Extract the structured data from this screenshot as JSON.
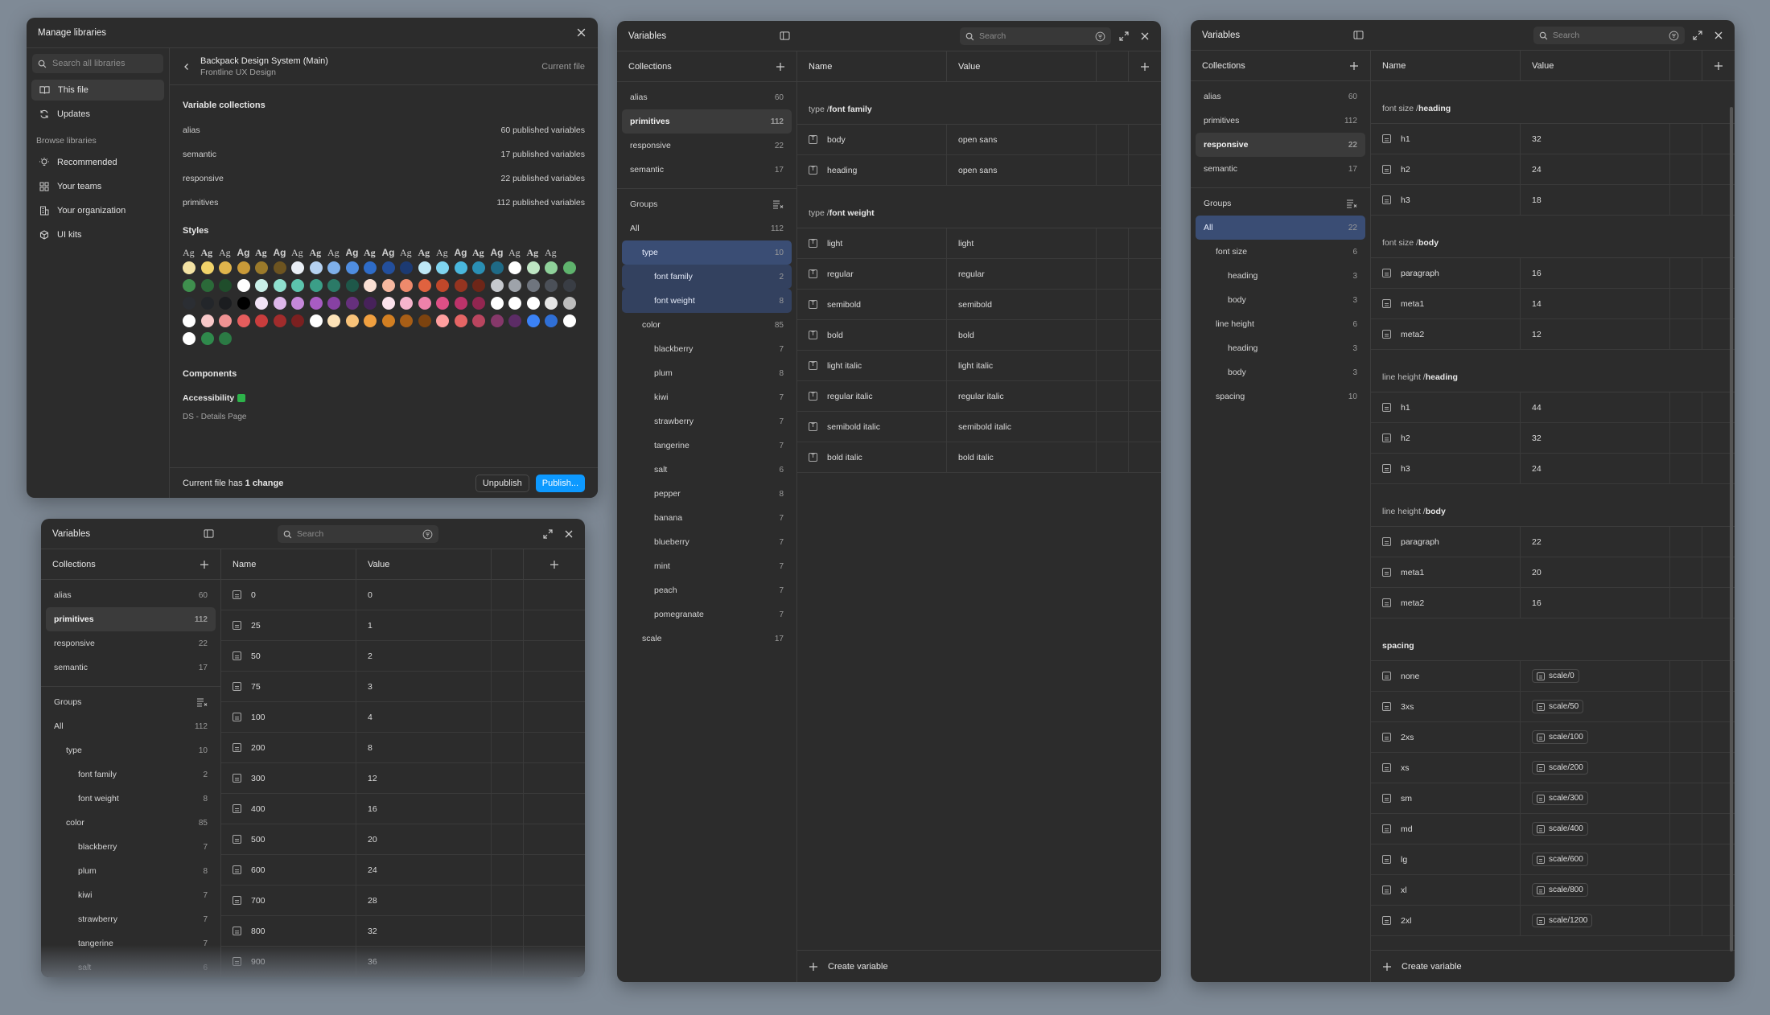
{
  "manage": {
    "title": "Manage libraries",
    "search_placeholder": "Search all libraries",
    "nav": [
      {
        "label": "This file",
        "icon": "book-icon"
      },
      {
        "label": "Updates",
        "icon": "refresh-icon"
      }
    ],
    "browse_label": "Browse libraries",
    "browse": [
      {
        "label": "Recommended",
        "icon": "bulb-icon"
      },
      {
        "label": "Your teams",
        "icon": "grid-icon"
      },
      {
        "label": "Your organization",
        "icon": "building-icon"
      },
      {
        "label": "UI kits",
        "icon": "cube-icon"
      }
    ],
    "library_name": "Backpack Design System (Main)",
    "library_team": "Frontline UX Design",
    "current_file": "Current file",
    "variable_collections_label": "Variable collections",
    "collections": [
      {
        "name": "alias",
        "count": "60 published variables"
      },
      {
        "name": "semantic",
        "count": "17 published variables"
      },
      {
        "name": "responsive",
        "count": "22 published variables"
      },
      {
        "name": "primitives",
        "count": "112 published variables"
      }
    ],
    "styles_label": "Styles",
    "ag_text": "Ag",
    "components_label": "Components",
    "accessibility": "Accessibility",
    "ds_details": "DS - Details Page",
    "footer_text_pre": "Current file has ",
    "footer_text_bold": "1 change",
    "unpublish": "Unpublish",
    "publish": "Publish...",
    "swatches": [
      "#f3e2a4",
      "#f1d36a",
      "#e0b44c",
      "#c99a38",
      "#9b7a2a",
      "#6d5420",
      "#e9eef5",
      "#b6d2f1",
      "#7fb0ea",
      "#4f8de0",
      "#2e6cc8",
      "#234f9c",
      "#1c3a72",
      "#bfe9f7",
      "#7fd4ef",
      "#49b7dd",
      "#2a8fb4",
      "#1f6a86",
      "#ffffff",
      "#bfe6c4",
      "#8fd19a",
      "#5fb36d",
      "#3f8f4e",
      "#2b6a39",
      "#1f4d2b",
      "#ffffff",
      "#c9f0e8",
      "#8fe0cf",
      "#5cc4ad",
      "#3b9f88",
      "#2b7a67",
      "#1e5749",
      "#fbe0d4",
      "#f6b8a0",
      "#ee8a6c",
      "#e0623f",
      "#c0472a",
      "#953420",
      "#6e2618",
      "#c6c9ce",
      "#9ea3aa",
      "#6f757e",
      "#4b5058",
      "#393d44",
      "#2b2e33",
      "#23262a",
      "#1b1d20",
      "#000000",
      "#f2e4f6",
      "#ddb7ea",
      "#c588da",
      "#a85cc3",
      "#8741a3",
      "#66307d",
      "#47225a",
      "#fbe2ec",
      "#f6b4cd",
      "#ee82ab",
      "#df4f86",
      "#bd336a",
      "#922650",
      "#ffffff",
      "#ffffff",
      "#ffffff",
      "#e6e6e6",
      "#bdbdbd",
      "#ffffff",
      "#f8c9c9",
      "#f09393",
      "#e55d5d",
      "#c93d3d",
      "#a12c2c",
      "#7b2020",
      "#ffffff",
      "#fde3b8",
      "#f9c379",
      "#f0a040",
      "#d27f22",
      "#a85e16",
      "#7c430f",
      "#ff9f9f",
      "#e56565",
      "#b9455f",
      "#86386a",
      "#5c2c66",
      "#3b82f6",
      "#2f6fd6",
      "#ffffff",
      "#ffffff",
      "#2f8a4c",
      "#2b7a44"
    ]
  },
  "v1": {
    "title": "Variables",
    "search_placeholder": "Search",
    "collections_label": "Collections",
    "collections": [
      {
        "label": "alias",
        "count": "60",
        "state": ""
      },
      {
        "label": "primitives",
        "count": "112",
        "state": "sel"
      },
      {
        "label": "responsive",
        "count": "22",
        "state": ""
      },
      {
        "label": "semantic",
        "count": "17",
        "state": ""
      }
    ],
    "groups_label": "Groups",
    "groups": [
      {
        "label": "All",
        "count": "112",
        "indent": 0
      },
      {
        "label": "type",
        "count": "10",
        "indent": 1
      },
      {
        "label": "font family",
        "count": "2",
        "indent": 2
      },
      {
        "label": "font weight",
        "count": "8",
        "indent": 2
      },
      {
        "label": "color",
        "count": "85",
        "indent": 1
      },
      {
        "label": "blackberry",
        "count": "7",
        "indent": 2
      },
      {
        "label": "plum",
        "count": "8",
        "indent": 2
      },
      {
        "label": "kiwi",
        "count": "7",
        "indent": 2
      },
      {
        "label": "strawberry",
        "count": "7",
        "indent": 2
      },
      {
        "label": "tangerine",
        "count": "7",
        "indent": 2
      },
      {
        "label": "salt",
        "count": "6",
        "indent": 2
      }
    ],
    "col_name": "Name",
    "col_value": "Value",
    "rows": [
      [
        "0",
        "0"
      ],
      [
        "25",
        "1"
      ],
      [
        "50",
        "2"
      ],
      [
        "75",
        "3"
      ],
      [
        "100",
        "4"
      ],
      [
        "200",
        "8"
      ],
      [
        "300",
        "12"
      ],
      [
        "400",
        "16"
      ],
      [
        "500",
        "20"
      ],
      [
        "600",
        "24"
      ],
      [
        "700",
        "28"
      ],
      [
        "800",
        "32"
      ],
      [
        "900",
        "36"
      ]
    ]
  },
  "v2": {
    "title": "Variables",
    "search_placeholder": "Search",
    "collections_label": "Collections",
    "collections": [
      {
        "label": "alias",
        "count": "60",
        "state": ""
      },
      {
        "label": "primitives",
        "count": "112",
        "state": "sel"
      },
      {
        "label": "responsive",
        "count": "22",
        "state": ""
      },
      {
        "label": "semantic",
        "count": "17",
        "state": ""
      }
    ],
    "groups_label": "Groups",
    "groups": [
      {
        "label": "All",
        "count": "112",
        "indent": 0,
        "state": ""
      },
      {
        "label": "type",
        "count": "10",
        "indent": 1,
        "state": "blue"
      },
      {
        "label": "font family",
        "count": "2",
        "indent": 2,
        "state": "bluel"
      },
      {
        "label": "font weight",
        "count": "8",
        "indent": 2,
        "state": "bluel"
      },
      {
        "label": "color",
        "count": "85",
        "indent": 1,
        "state": ""
      },
      {
        "label": "blackberry",
        "count": "7",
        "indent": 2,
        "state": ""
      },
      {
        "label": "plum",
        "count": "8",
        "indent": 2,
        "state": ""
      },
      {
        "label": "kiwi",
        "count": "7",
        "indent": 2,
        "state": ""
      },
      {
        "label": "strawberry",
        "count": "7",
        "indent": 2,
        "state": ""
      },
      {
        "label": "tangerine",
        "count": "7",
        "indent": 2,
        "state": ""
      },
      {
        "label": "salt",
        "count": "6",
        "indent": 2,
        "state": ""
      },
      {
        "label": "pepper",
        "count": "8",
        "indent": 2,
        "state": ""
      },
      {
        "label": "banana",
        "count": "7",
        "indent": 2,
        "state": ""
      },
      {
        "label": "blueberry",
        "count": "7",
        "indent": 2,
        "state": ""
      },
      {
        "label": "mint",
        "count": "7",
        "indent": 2,
        "state": ""
      },
      {
        "label": "peach",
        "count": "7",
        "indent": 2,
        "state": ""
      },
      {
        "label": "pomegranate",
        "count": "7",
        "indent": 2,
        "state": ""
      },
      {
        "label": "scale",
        "count": "17",
        "indent": 1,
        "state": ""
      }
    ],
    "col_name": "Name",
    "col_value": "Value",
    "sections": [
      {
        "prefix": "type / ",
        "bold": "font family",
        "rows": [
          [
            "body",
            "open sans"
          ],
          [
            "heading",
            "open sans"
          ]
        ]
      },
      {
        "prefix": "type / ",
        "bold": "font weight",
        "rows": [
          [
            "light",
            "light"
          ],
          [
            "regular",
            "regular"
          ],
          [
            "semibold",
            "semibold"
          ],
          [
            "bold",
            "bold"
          ],
          [
            "light italic",
            "light italic"
          ],
          [
            "regular italic",
            "regular italic"
          ],
          [
            "semibold italic",
            "semibold italic"
          ],
          [
            "bold italic",
            "bold italic"
          ]
        ]
      }
    ],
    "create_label": "Create variable"
  },
  "v3": {
    "title": "Variables",
    "search_placeholder": "Search",
    "collections_label": "Collections",
    "collections": [
      {
        "label": "alias",
        "count": "60",
        "state": ""
      },
      {
        "label": "primitives",
        "count": "112",
        "state": ""
      },
      {
        "label": "responsive",
        "count": "22",
        "state": "sel"
      },
      {
        "label": "semantic",
        "count": "17",
        "state": ""
      }
    ],
    "groups_label": "Groups",
    "groups": [
      {
        "label": "All",
        "count": "22",
        "indent": 0,
        "state": "blue"
      },
      {
        "label": "font size",
        "count": "6",
        "indent": 1,
        "state": ""
      },
      {
        "label": "heading",
        "count": "3",
        "indent": 2,
        "state": ""
      },
      {
        "label": "body",
        "count": "3",
        "indent": 2,
        "state": ""
      },
      {
        "label": "line height",
        "count": "6",
        "indent": 1,
        "state": ""
      },
      {
        "label": "heading",
        "count": "3",
        "indent": 2,
        "state": ""
      },
      {
        "label": "body",
        "count": "3",
        "indent": 2,
        "state": ""
      },
      {
        "label": "spacing",
        "count": "10",
        "indent": 1,
        "state": ""
      }
    ],
    "col_name": "Name",
    "col_value": "Value",
    "sections": [
      {
        "prefix": "font size / ",
        "bold": "heading",
        "rows": [
          [
            "h1",
            "32"
          ],
          [
            "h2",
            "24"
          ],
          [
            "h3",
            "18"
          ]
        ]
      },
      {
        "prefix": "font size / ",
        "bold": "body",
        "rows": [
          [
            "paragraph",
            "16"
          ],
          [
            "meta1",
            "14"
          ],
          [
            "meta2",
            "12"
          ]
        ]
      },
      {
        "prefix": "line height / ",
        "bold": "heading",
        "rows": [
          [
            "h1",
            "44"
          ],
          [
            "h2",
            "32"
          ],
          [
            "h3",
            "24"
          ]
        ]
      },
      {
        "prefix": "line height / ",
        "bold": "body",
        "rows": [
          [
            "paragraph",
            "22"
          ],
          [
            "meta1",
            "20"
          ],
          [
            "meta2",
            "16"
          ]
        ]
      },
      {
        "prefix": "",
        "bold": "spacing",
        "alias": true,
        "rows": [
          [
            "none",
            "scale/0"
          ],
          [
            "3xs",
            "scale/50"
          ],
          [
            "2xs",
            "scale/100"
          ],
          [
            "xs",
            "scale/200"
          ],
          [
            "sm",
            "scale/300"
          ],
          [
            "md",
            "scale/400"
          ],
          [
            "lg",
            "scale/600"
          ],
          [
            "xl",
            "scale/800"
          ],
          [
            "2xl",
            "scale/1200"
          ]
        ]
      }
    ],
    "create_label": "Create variable"
  }
}
